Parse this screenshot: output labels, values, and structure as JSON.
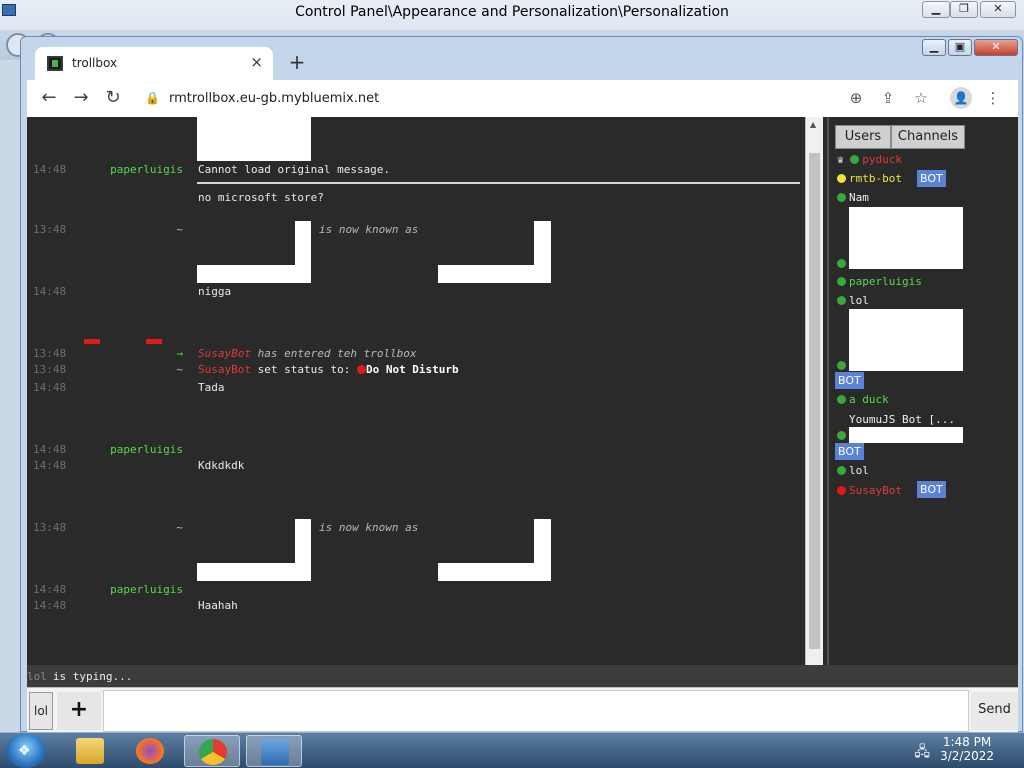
{
  "background_window": {
    "title": "Control Panel\\Appearance and Personalization\\Personalization",
    "minimize": "▁",
    "maximize": "❐",
    "close": "✕"
  },
  "browser": {
    "tab_label": "trollbox",
    "tab_close": "×",
    "new_tab": "+",
    "back": "←",
    "forward": "→",
    "reload": "↻",
    "lock": "🔒",
    "url": "rmtrollbox.eu-gb.mybluemix.net",
    "zoom": "⊕",
    "share": "⇪",
    "star": "☆",
    "profile": "👤",
    "menu": "⋮",
    "win_min": "▁",
    "win_max": "▣",
    "win_close": "✕"
  },
  "chat": {
    "messages": [
      {
        "time": "14:48",
        "nick": "paperluigis",
        "text": "Cannot load original message."
      },
      {
        "time": "",
        "nick": "",
        "text": "no microsoft store?"
      },
      {
        "time": "13:48",
        "nick": "~",
        "text": "is now known as"
      },
      {
        "time": "14:48",
        "nick": "",
        "text": "nigga"
      },
      {
        "time": "13:48",
        "nick": "→",
        "user": "SusayBot",
        "text": "has entered teh trollbox"
      },
      {
        "time": "13:48",
        "nick": "~",
        "user": "SusayBot",
        "text": "set status to:",
        "status": "Do Not Disturb"
      },
      {
        "time": "14:48",
        "nick": "",
        "text": "Tada"
      },
      {
        "time": "14:48",
        "nick": "paperluigis",
        "text": ""
      },
      {
        "time": "14:48",
        "nick": "",
        "text": "Kdkdkdk"
      },
      {
        "time": "13:48",
        "nick": "~",
        "text": "is now known as"
      },
      {
        "time": "14:48",
        "nick": "paperluigis",
        "text": ""
      },
      {
        "time": "14:48",
        "nick": "",
        "text": "Haahah"
      }
    ]
  },
  "sidebar": {
    "tabs": [
      "Users",
      "Channels"
    ],
    "crown": "♛",
    "bot_label": "BOT",
    "users": [
      {
        "name": "pyduck",
        "color": "#e03a3a",
        "dot": "#3aa83a"
      },
      {
        "name": "rmtb-bot",
        "color": "#f2e33a",
        "dot": "#f2e33a"
      },
      {
        "name": "Nam",
        "color": "#eaeaea",
        "dot": "#3aa83a"
      },
      {
        "name": "paperluigis",
        "color": "#59d84a",
        "dot": "#3aa83a"
      },
      {
        "name": "lol",
        "color": "#eaeaea",
        "dot": "#3aa83a"
      },
      {
        "name": "a duck",
        "color": "#59d84a",
        "dot": "#3aa83a"
      },
      {
        "name": "YoumuJS Bot [...",
        "color": "#eaeaea",
        "dot": "#3aa83a"
      },
      {
        "name": "lol",
        "color": "#eaeaea",
        "dot": "#3aa83a"
      },
      {
        "name": "SusayBot",
        "color": "#e03a3a",
        "dot": "#e01919"
      }
    ]
  },
  "status_bar": {
    "who": "lol",
    "text": "is typing..."
  },
  "input": {
    "nick_button": "lol",
    "plus": "+",
    "send": "Send"
  },
  "taskbar": {
    "start": "❖",
    "time": "1:48 PM",
    "date": "3/2/2022"
  }
}
